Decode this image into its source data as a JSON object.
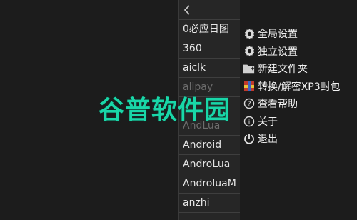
{
  "file_list": {
    "items": [
      {
        "label": "0必应日图",
        "dim": false
      },
      {
        "label": "360",
        "dim": false
      },
      {
        "label": "aiclk",
        "dim": false
      },
      {
        "label": "alipay",
        "dim": true
      },
      {
        "label": "",
        "dim": true
      },
      {
        "label": "AndLua",
        "dim": true
      },
      {
        "label": "Android",
        "dim": false
      },
      {
        "label": "AndroLua",
        "dim": false
      },
      {
        "label": "AndroluaM",
        "dim": false
      },
      {
        "label": "anzhi",
        "dim": false
      }
    ]
  },
  "menu": {
    "items": [
      {
        "label": "全局设置",
        "icon": "gear-icon"
      },
      {
        "label": "独立设置",
        "icon": "gear-icon"
      },
      {
        "label": "新建文件夹",
        "icon": "new-folder-icon"
      },
      {
        "label": "转换/解密XP3封包",
        "icon": "package-icon"
      },
      {
        "label": "查看帮助",
        "icon": "help-icon"
      },
      {
        "label": "关于",
        "icon": "info-icon"
      },
      {
        "label": "退出",
        "icon": "power-icon"
      }
    ]
  },
  "watermark": {
    "text": "谷普软件园"
  }
}
